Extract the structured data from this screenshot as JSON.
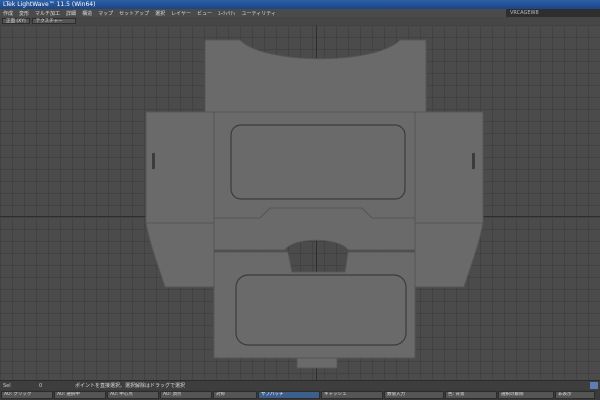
{
  "window": {
    "title": "LTek LightWave™ 11.5 (Win64)"
  },
  "menu": {
    "items": [
      "作成",
      "変形",
      "マルチ加工",
      "詳細",
      "構造",
      "マップ",
      "セットアップ",
      "選択",
      "レイヤー",
      "ビュー",
      "ﾕｰﾃｨﾘﾃｨ",
      "ユーティリティ"
    ],
    "layer_label": "VRCAGEW8"
  },
  "view": {
    "projection": "正面 (XY)",
    "shading": "テクスチャー"
  },
  "status": {
    "sel_label": "Sel",
    "sel_value": "0",
    "message": "ポイントを直接選択。選択解除はドラッグで選択"
  },
  "bottom_buttons": [
    {
      "label": "AO: クリック"
    },
    {
      "label": "AO: 選択中"
    },
    {
      "label": "AO: 中心点"
    },
    {
      "label": "AO: 頂点"
    },
    {
      "label": "対称"
    },
    {
      "label": "サブパッチ",
      "active": true
    },
    {
      "label": "キャッシュ"
    },
    {
      "label": "数値入力"
    },
    {
      "label": "色: 背景"
    },
    {
      "label": "選択の解除"
    },
    {
      "label": "非表示"
    }
  ],
  "colors": {
    "titlebar": "#2b5fa8",
    "model_fill": "#6a6a6a",
    "grid_bg": "#4b4b4b"
  }
}
